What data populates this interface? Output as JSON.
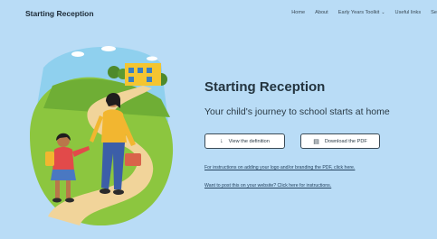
{
  "header": {
    "brand": "Starting Reception",
    "nav": [
      {
        "label": "Home"
      },
      {
        "label": "About"
      },
      {
        "label": "Early Years Toolkit",
        "has_dropdown": true
      },
      {
        "label": "Useful links"
      },
      {
        "label": "Se"
      }
    ]
  },
  "hero": {
    "title": "Starting Reception",
    "subtitle": "Your child's journey to school starts at home",
    "buttons": {
      "definition": {
        "label": "View the definition",
        "icon": "arrow-down-icon"
      },
      "pdf": {
        "label": "Download the PDF",
        "icon": "document-icon"
      }
    },
    "links": {
      "branding": "For instructions on adding your logo and/or branding the PDF, click here.",
      "website": "Want to post this on your website? Click here for instructions."
    }
  },
  "colors": {
    "background": "#b9dcf6",
    "text": "#23343f",
    "button_bg": "#ffffff"
  }
}
